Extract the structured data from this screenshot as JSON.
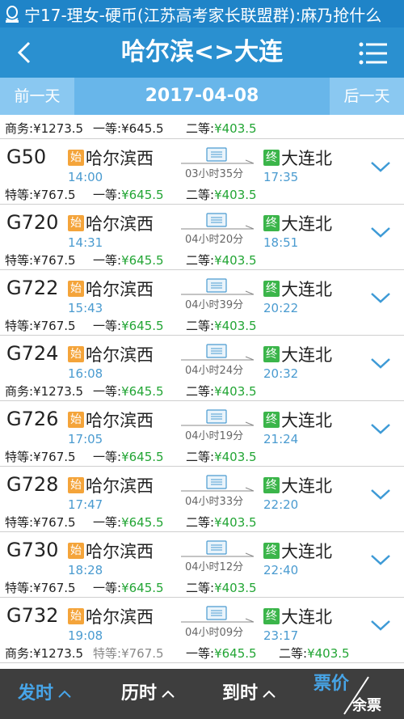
{
  "notification": {
    "text": "宁17-理女-硬币(江苏高考家长联盟群):麻乃抢什么",
    "icon": "qq-chat-icon"
  },
  "header": {
    "title": "哈尔滨<>大连",
    "back_icon": "back-icon",
    "menu_icon": "menu-icon"
  },
  "datebar": {
    "prev_label": "前一天",
    "date": "2017-04-08",
    "next_label": "后一天"
  },
  "partial_row": {
    "prices": [
      {
        "label": "商务:",
        "value": "¥1273.5",
        "green": false
      },
      {
        "label": "一等:",
        "value": "¥645.5",
        "green": false
      },
      {
        "label": "二等:",
        "value": "¥403.5",
        "green": true
      }
    ]
  },
  "trains": [
    {
      "code": "G50",
      "start_badge": "始",
      "from": "哈尔滨西",
      "depart": "14:00",
      "duration": "03小时35分",
      "end_badge": "终",
      "to": "大连北",
      "arrive": "17:35",
      "prices": [
        {
          "label": "特等:",
          "value": "¥767.5",
          "green": false
        },
        {
          "label": "一等:",
          "value": "¥645.5",
          "green": true
        },
        {
          "label": "二等:",
          "value": "¥403.5",
          "green": true
        }
      ]
    },
    {
      "code": "G720",
      "start_badge": "始",
      "from": "哈尔滨西",
      "depart": "14:31",
      "duration": "04小时20分",
      "end_badge": "终",
      "to": "大连北",
      "arrive": "18:51",
      "prices": [
        {
          "label": "特等:",
          "value": "¥767.5",
          "green": false
        },
        {
          "label": "一等:",
          "value": "¥645.5",
          "green": true
        },
        {
          "label": "二等:",
          "value": "¥403.5",
          "green": true
        }
      ]
    },
    {
      "code": "G722",
      "start_badge": "始",
      "from": "哈尔滨西",
      "depart": "15:43",
      "duration": "04小时39分",
      "end_badge": "终",
      "to": "大连北",
      "arrive": "20:22",
      "prices": [
        {
          "label": "特等:",
          "value": "¥767.5",
          "green": false
        },
        {
          "label": "一等:",
          "value": "¥645.5",
          "green": true
        },
        {
          "label": "二等:",
          "value": "¥403.5",
          "green": true
        }
      ]
    },
    {
      "code": "G724",
      "start_badge": "始",
      "from": "哈尔滨西",
      "depart": "16:08",
      "duration": "04小时24分",
      "end_badge": "终",
      "to": "大连北",
      "arrive": "20:32",
      "prices": [
        {
          "label": "商务:",
          "value": "¥1273.5",
          "green": false
        },
        {
          "label": "一等:",
          "value": "¥645.5",
          "green": true
        },
        {
          "label": "二等:",
          "value": "¥403.5",
          "green": true
        }
      ]
    },
    {
      "code": "G726",
      "start_badge": "始",
      "from": "哈尔滨西",
      "depart": "17:05",
      "duration": "04小时19分",
      "end_badge": "终",
      "to": "大连北",
      "arrive": "21:24",
      "prices": [
        {
          "label": "特等:",
          "value": "¥767.5",
          "green": false
        },
        {
          "label": "一等:",
          "value": "¥645.5",
          "green": true
        },
        {
          "label": "二等:",
          "value": "¥403.5",
          "green": true
        }
      ]
    },
    {
      "code": "G728",
      "start_badge": "始",
      "from": "哈尔滨西",
      "depart": "17:47",
      "duration": "04小时33分",
      "end_badge": "终",
      "to": "大连北",
      "arrive": "22:20",
      "prices": [
        {
          "label": "特等:",
          "value": "¥767.5",
          "green": false
        },
        {
          "label": "一等:",
          "value": "¥645.5",
          "green": true
        },
        {
          "label": "二等:",
          "value": "¥403.5",
          "green": true
        }
      ]
    },
    {
      "code": "G730",
      "start_badge": "始",
      "from": "哈尔滨西",
      "depart": "18:28",
      "duration": "04小时12分",
      "end_badge": "终",
      "to": "大连北",
      "arrive": "22:40",
      "prices": [
        {
          "label": "特等:",
          "value": "¥767.5",
          "green": false
        },
        {
          "label": "一等:",
          "value": "¥645.5",
          "green": true
        },
        {
          "label": "二等:",
          "value": "¥403.5",
          "green": true
        }
      ]
    },
    {
      "code": "G732",
      "start_badge": "始",
      "from": "哈尔滨西",
      "depart": "19:08",
      "duration": "04小时09分",
      "end_badge": "终",
      "to": "大连北",
      "arrive": "23:17",
      "prices": [
        {
          "label": "商务:",
          "value": "¥1273.5",
          "green": false
        },
        {
          "label": "特等:",
          "value": "¥767.5",
          "green": false,
          "faded": true
        },
        {
          "label": "一等:",
          "value": "¥645.5",
          "green": true
        },
        {
          "label": "二等:",
          "value": "¥403.5",
          "green": true
        }
      ]
    }
  ],
  "bottombar": {
    "sort_depart": "发时",
    "sort_duration": "历时",
    "sort_arrive": "到时",
    "price_label": "票价",
    "remaining_label": "余票"
  },
  "colors": {
    "header": "#2a90d0",
    "datebar": "#68b6ea",
    "accent": "#47a5e8",
    "green": "#22a534",
    "start_badge": "#f4a43a",
    "end_badge": "#3bb54a"
  }
}
